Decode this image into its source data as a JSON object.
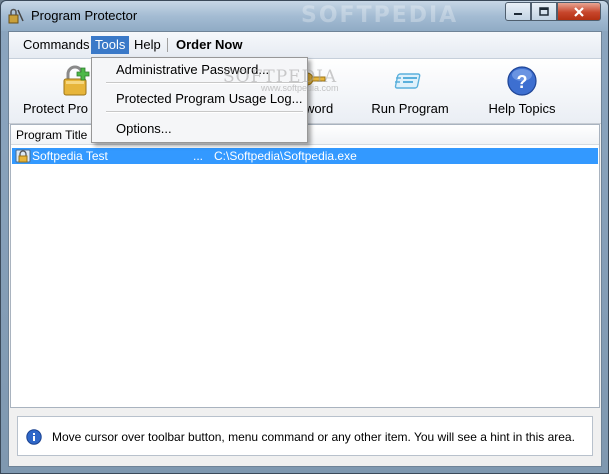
{
  "window": {
    "title": "Program Protector",
    "watermark": "SOFTPEDIA"
  },
  "menubar": {
    "items": [
      "Commands",
      "Tools",
      "Help",
      "Order Now"
    ],
    "active": "Tools"
  },
  "tools_menu": {
    "items": [
      "Administrative Password...",
      "Protected Program Usage Log...",
      "Options..."
    ],
    "watermark": "SOFTPEDIA",
    "watermark_sub": "www.softpedia.com"
  },
  "toolbar": {
    "buttons": [
      {
        "label": "Protect Pro",
        "icon": "padlock-add-icon"
      },
      {
        "label": "ssword",
        "icon": "key-icon"
      },
      {
        "label": "Run Program",
        "icon": "run-program-icon"
      },
      {
        "label": "Help Topics",
        "icon": "help-icon"
      }
    ]
  },
  "listview": {
    "columns": [
      "Program Title"
    ],
    "rows": [
      {
        "title": "Softpedia Test",
        "ellipsis": "...",
        "path": "C:\\Softpedia\\Softpedia.exe",
        "selected": true
      }
    ]
  },
  "hint": {
    "text": "Move cursor over toolbar button, menu command or any other item. You will see a hint in this area."
  },
  "colors": {
    "selection": "#3399ff",
    "menu_highlight": "#3a79c8",
    "close_button": "#c7462c"
  }
}
